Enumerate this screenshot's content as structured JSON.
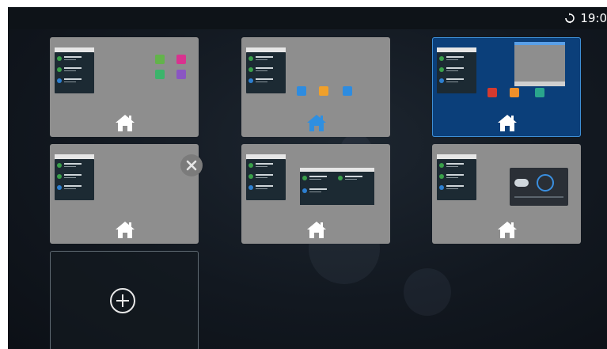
{
  "status_bar": {
    "time": "19:0",
    "sync_icon": "sync-icon"
  },
  "home_screens": [
    {
      "index": 1,
      "apps": [
        "green-app-icon",
        "pink-music-icon",
        "green-chat-icon",
        "purple-gallery-icon"
      ]
    },
    {
      "index": 2,
      "apps": [
        "blue-app-icon",
        "orange-folder-icon",
        "blue-app-icon"
      ],
      "default_home": true
    },
    {
      "index": 3,
      "apps": [
        "red-app-icon",
        "orange-phone-icon",
        "teal-camera-icon"
      ],
      "selected": true
    },
    {
      "index": 4,
      "apps": [],
      "removable": true
    },
    {
      "index": 5,
      "apps": []
    },
    {
      "index": 6,
      "apps": [
        "weather-widget"
      ]
    }
  ],
  "controls": {
    "close_icon": "close-icon",
    "add_icon": "plus-circle-icon"
  },
  "colors": {
    "selected_tile": "#0b3f7a",
    "tile": "#8e8e8e",
    "default_home_icon": "#2f8fe0",
    "home_icon": "#ffffff"
  }
}
